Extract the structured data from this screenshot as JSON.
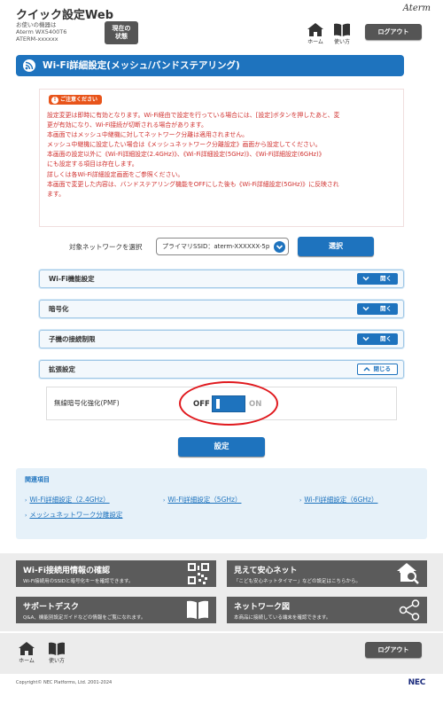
{
  "header": {
    "app_title": "クイック設定Web",
    "device_line1": "お使いの機器は",
    "device_line2": "Aterm WX5400T6",
    "device_line3": "ATERM-xxxxxx",
    "status_line1": "現在の",
    "status_line2": "状態",
    "brand": "Aterm",
    "home_label": "ホーム",
    "howto_label": "使い方",
    "logout_label": "ログアウト"
  },
  "section_title": "Wi-Fi詳細設定(メッシュ/バンドステアリング)",
  "notice": {
    "badge": "ご注意ください",
    "lines": [
      "設定変更は即時に有効となります。Wi-Fi経由で設定を行っている場合には、[設定]ボタンを押したあと、変",
      "更が有効になり、Wi-Fi接続が切断される場合があります。",
      "本画面ではメッシュ中継機に対してネットワーク分離は適用されません。",
      "メッシュ中継機に設定したい場合は《メッシュネットワーク分離設定》画面から設定してください。",
      "本画面の設定以外に《Wi-Fi詳細設定(2.4GHz)》、《Wi-Fi詳細設定(5GHz)》、《Wi-Fi詳細設定(6GHz)》",
      "にも設定する項目は存在します。",
      "詳しくは各Wi-Fi詳細設定画面をご参照ください。",
      "本画面で変更した内容は、バンドステアリング機能をOFFにした後も《Wi-Fi詳細設定(5GHz)》に反映され",
      "ます。"
    ]
  },
  "network_select": {
    "label": "対象ネットワークを選択",
    "value": "プライマリSSID：aterm-XXXXXX-5p",
    "button": "選択"
  },
  "accordions": [
    {
      "label": "Wi-Fi機能設定",
      "button": "開く",
      "state": "closed"
    },
    {
      "label": "暗号化",
      "button": "開く",
      "state": "closed"
    },
    {
      "label": "子機の接続制限",
      "button": "開く",
      "state": "closed"
    },
    {
      "label": "拡張設定",
      "button": "閉じる",
      "state": "open"
    }
  ],
  "pmf": {
    "label": "無線暗号化強化(PMF)",
    "off": "OFF",
    "on": "ON"
  },
  "set_button": "設定",
  "related": {
    "title": "関連項目",
    "links": [
      "Wi-Fi詳細設定（2.4GHz）",
      "Wi-Fi詳細設定（5GHz）",
      "Wi-Fi詳細設定（6GHz）",
      "メッシュネットワーク分離設定"
    ]
  },
  "cards": [
    {
      "title": "Wi-Fi接続用情報の確認",
      "desc": "Wi-Fi接続用のSSIDと暗号化キーを確認できます。",
      "icon": "qr-code-icon"
    },
    {
      "title": "見えて安心ネット",
      "desc": "「こども安心ネットタイマー」などの設定はこちらから。",
      "icon": "home-search-icon"
    },
    {
      "title": "サポートデスク",
      "desc": "Q&A、機能別設定ガイドなどの情報をご覧になれます。",
      "icon": "book-icon"
    },
    {
      "title": "ネットワーク図",
      "desc": "本商品に接続している端末を確認できます。",
      "icon": "network-share-icon"
    }
  ],
  "footer": {
    "home_label": "ホーム",
    "howto_label": "使い方",
    "logout_label": "ログアウト",
    "copyright": "Copyright© NEC Platforms, Ltd. 2001-2024",
    "logo": "NEC"
  },
  "colors": {
    "accent": "#1e73be",
    "notice_red": "#d0302e",
    "badge_orange": "#e8541a",
    "card_gray": "#5b5b5b",
    "highlight_red": "#e0191e"
  }
}
